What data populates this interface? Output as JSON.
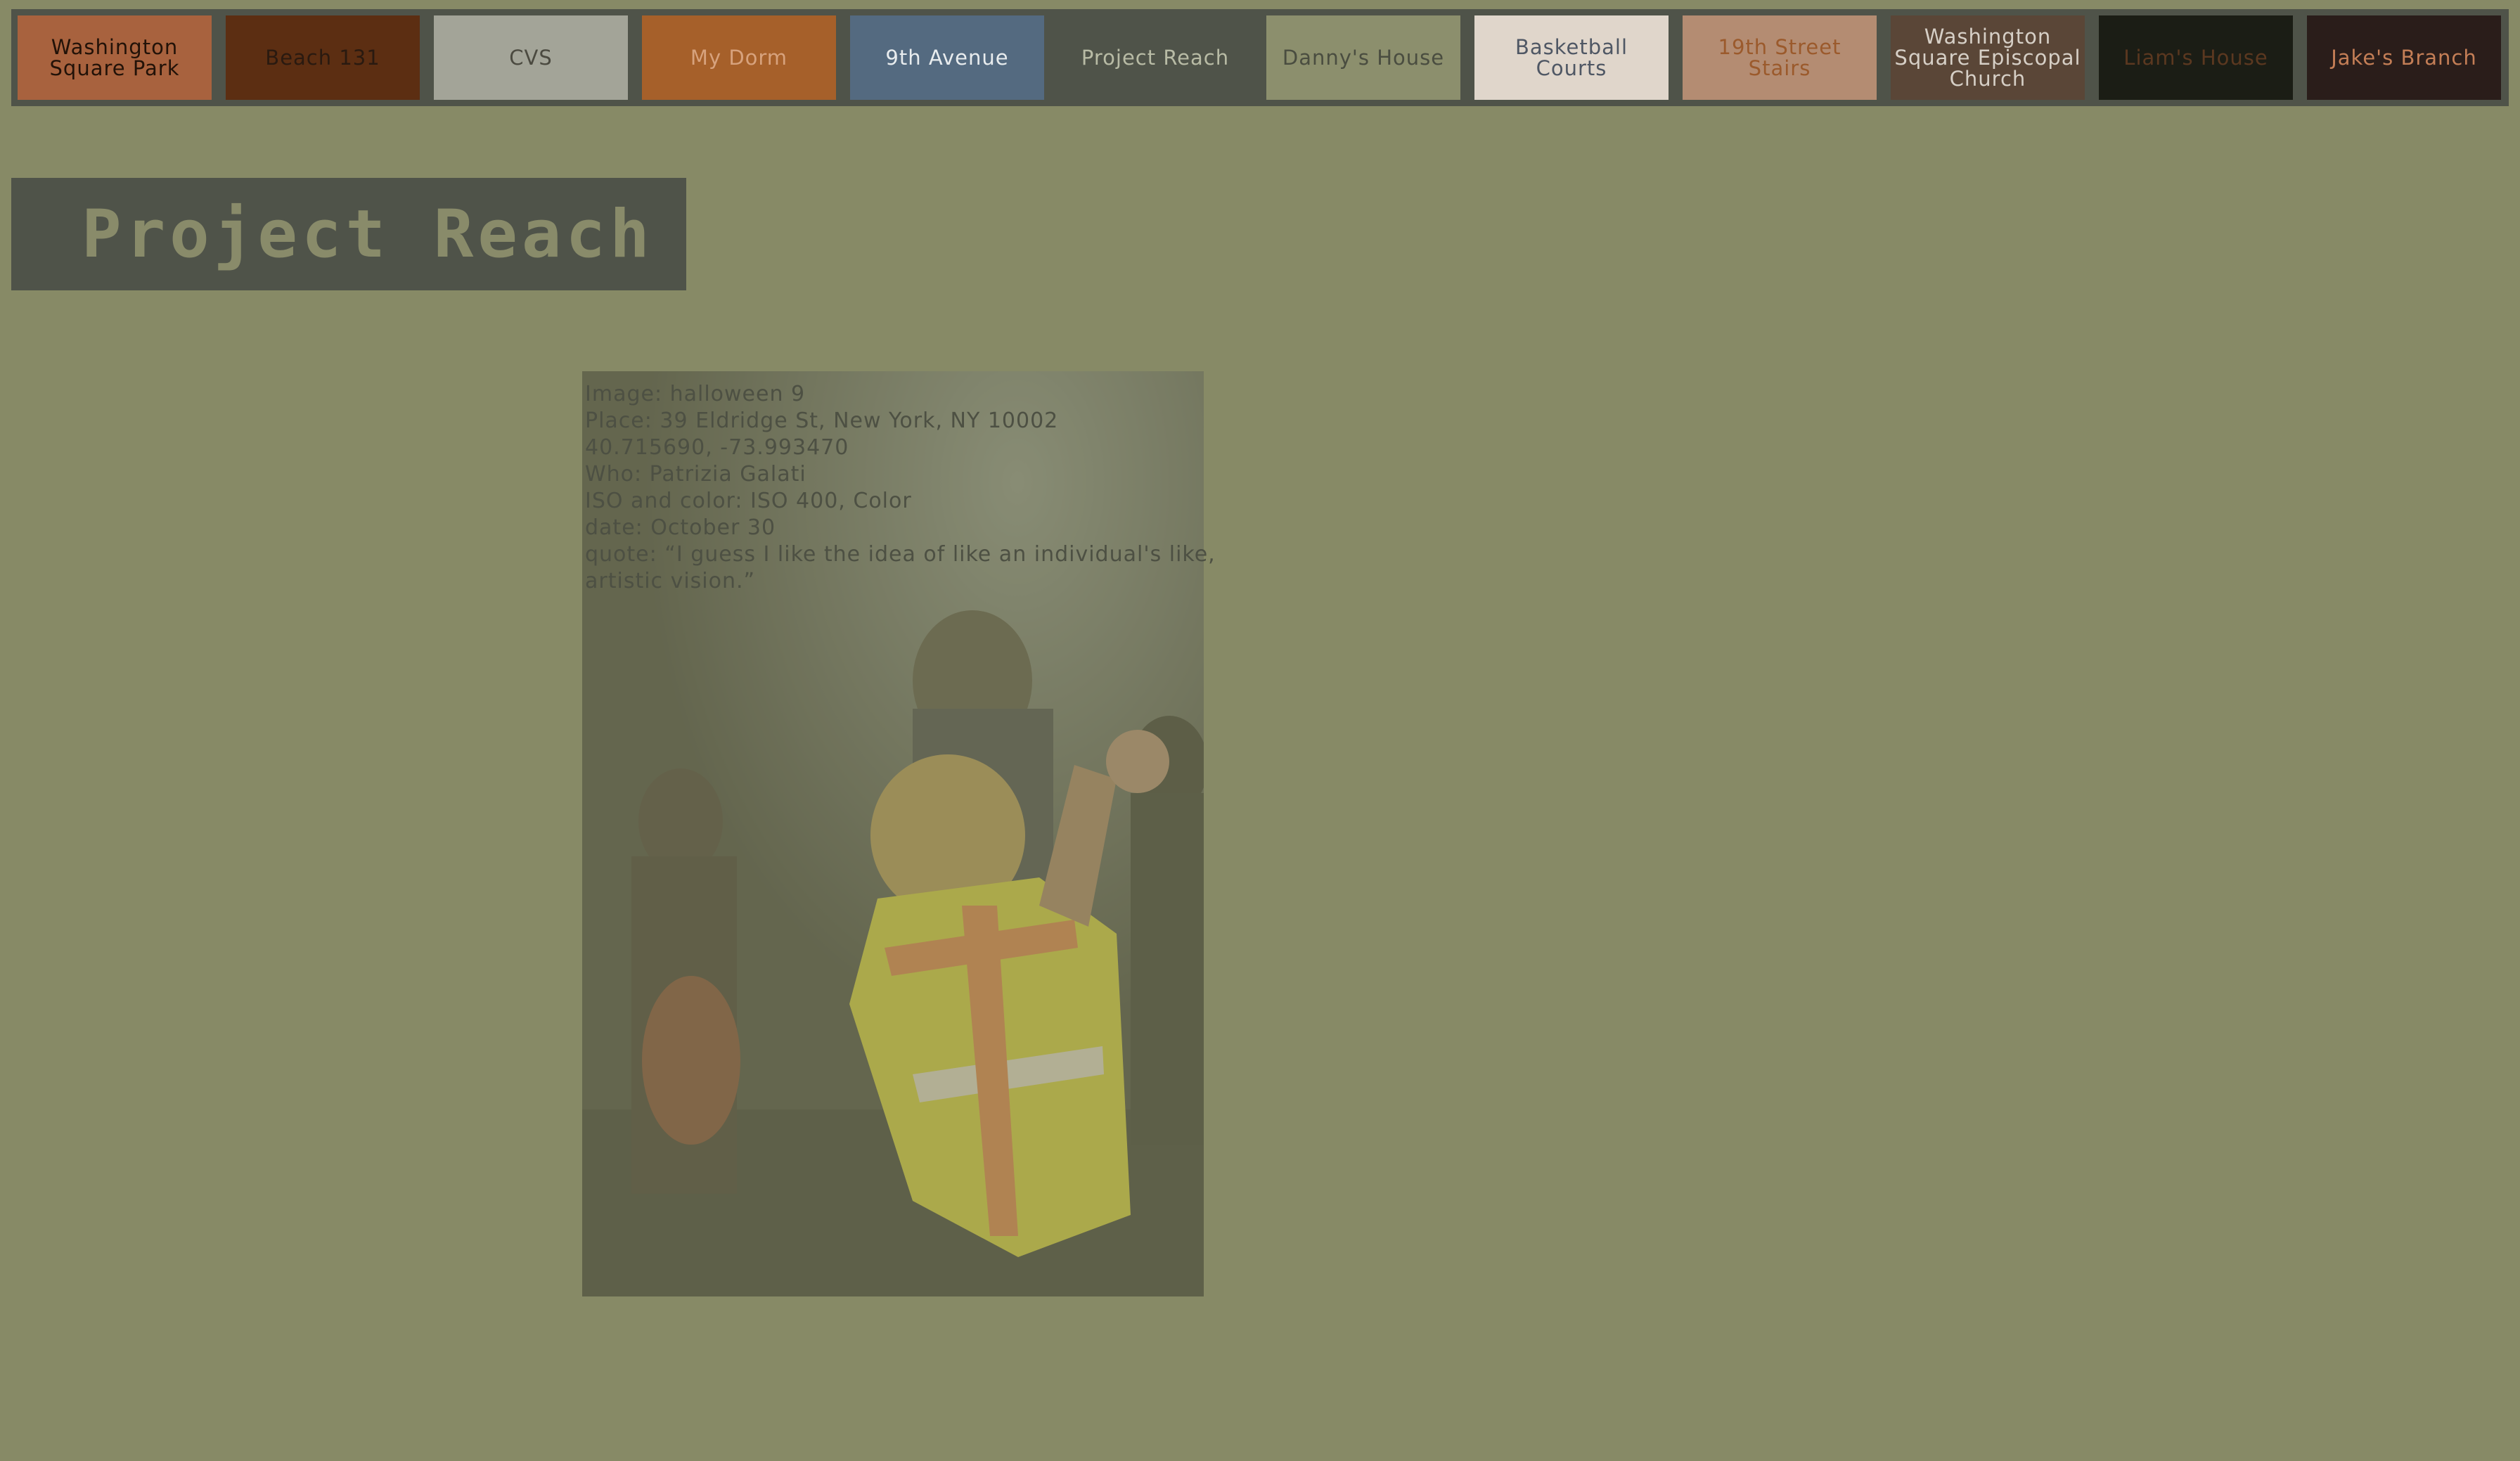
{
  "nav": {
    "items": [
      {
        "label": "Washington\nSquare Park",
        "bg": "#a8623e",
        "fg": "#221208"
      },
      {
        "label": "Beach 131",
        "bg": "#5c2e12",
        "fg": "#2a1a10"
      },
      {
        "label": "CVS",
        "bg": "#a3a498",
        "fg": "#4b4a40"
      },
      {
        "label": "My Dorm",
        "bg": "#a6602a",
        "fg": "#d7a27d"
      },
      {
        "label": "9th Avenue",
        "bg": "#546a80",
        "fg": "#e8ecee"
      },
      {
        "label": "Project Reach",
        "bg": "#4f5349",
        "fg": "#b8bba5"
      },
      {
        "label": "Danny's House",
        "bg": "#8c8f6d",
        "fg": "#4a4d40"
      },
      {
        "label": "Basketball Courts",
        "bg": "#e0d6cb",
        "fg": "#4f5764"
      },
      {
        "label": "19th Street\nStairs",
        "bg": "#b48c72",
        "fg": "#9b5a2c"
      },
      {
        "label": "Washington\nSquare Episcopal\nChurch",
        "bg": "#5a4637",
        "fg": "#d6cfc6"
      },
      {
        "label": "Liam's House",
        "bg": "#1b1d15",
        "fg": "#5b3820"
      },
      {
        "label": "Jake's Branch",
        "bg": "#2a1d1a",
        "fg": "#c47e56"
      }
    ]
  },
  "page": {
    "title": "Project Reach"
  },
  "photo": {
    "caption": {
      "image": "Image: halloween 9",
      "place": "Place: 39 Eldridge St, New York, NY 10002",
      "coords": "40.715690, -73.993470",
      "who": "Who: Patrizia Galati",
      "iso": "ISO and color: ISO 400, Color",
      "date": "date: October 30",
      "quote": "quote: “I guess I like the idea of like an individual's like, artistic vision.”"
    }
  }
}
